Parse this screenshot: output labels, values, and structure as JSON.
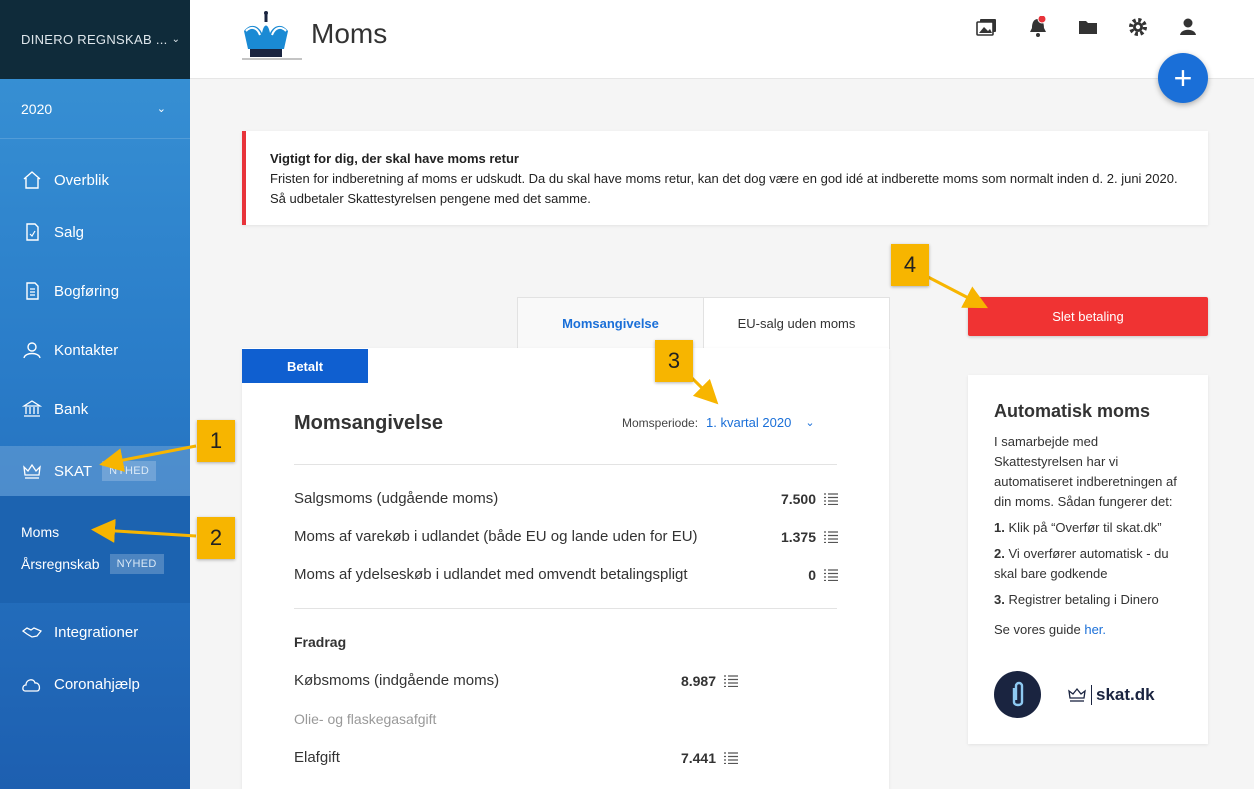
{
  "sidebar": {
    "company": "DINERO REGNSKAB ...",
    "year": "2020",
    "items": [
      {
        "label": "Overblik"
      },
      {
        "label": "Salg"
      },
      {
        "label": "Bogføring"
      },
      {
        "label": "Kontakter"
      },
      {
        "label": "Bank"
      },
      {
        "label": "SKAT",
        "badge": "NYHED"
      },
      {
        "label": "Integrationer"
      },
      {
        "label": "Coronahjælp"
      }
    ],
    "sub_items": [
      {
        "label": "Moms"
      },
      {
        "label": "Årsregnskab",
        "badge": "NYHED"
      }
    ]
  },
  "header": {
    "title": "Moms",
    "fab_label": "+"
  },
  "alert": {
    "title": "Vigtigt for dig, der skal have moms retur",
    "line1": "Fristen for indberetning af moms er udskudt. Da du skal have moms retur, kan det dog være en god idé at indberette moms som normalt inden d. 2. juni 2020.",
    "line2": "Så udbetaler Skattestyrelsen pengene med det samme."
  },
  "tabs": [
    {
      "label": "Momsangivelse"
    },
    {
      "label": "EU-salg uden moms"
    }
  ],
  "delete_button": "Slet betaling",
  "card": {
    "status": "Betalt",
    "title": "Momsangivelse",
    "period_label": "Momsperiode:",
    "period_value": "1. kvartal 2020",
    "rows": [
      {
        "label": "Salgsmoms (udgående moms)",
        "amount": "7.500"
      },
      {
        "label": "Moms af varekøb i udlandet (både EU og lande uden for EU)",
        "amount": "1.375"
      },
      {
        "label": "Moms af ydelseskøb i udlandet med omvendt betalingspligt",
        "amount": "0"
      }
    ],
    "deduction_heading": "Fradrag",
    "deductions": [
      {
        "label": "Købsmoms (indgående moms)",
        "amount": "8.987"
      },
      {
        "label": "Olie- og flaskegasafgift",
        "amount": ""
      },
      {
        "label": "Elafgift",
        "amount": "7.441"
      }
    ]
  },
  "auto_moms": {
    "title": "Automatisk moms",
    "intro": "I samarbejde med Skattestyrelsen har vi automatiseret indberetningen af din moms. Sådan fungerer det:",
    "steps": [
      {
        "num": "1.",
        "text": "Klik på “Overfør til skat.dk”"
      },
      {
        "num": "2.",
        "text": "Vi overfører automatisk - du skal bare godkende"
      },
      {
        "num": "3.",
        "text": "Registrer betaling i Dinero"
      }
    ],
    "guide_text": "Se vores guide ",
    "guide_link": "her.",
    "skat_logo": "skat.dk"
  },
  "callouts": [
    "1",
    "2",
    "3",
    "4"
  ],
  "colors": {
    "accent": "#1a6fd8",
    "danger": "#f03333",
    "callout": "#f7b500",
    "sidebar_dark": "#0f2b3a"
  }
}
